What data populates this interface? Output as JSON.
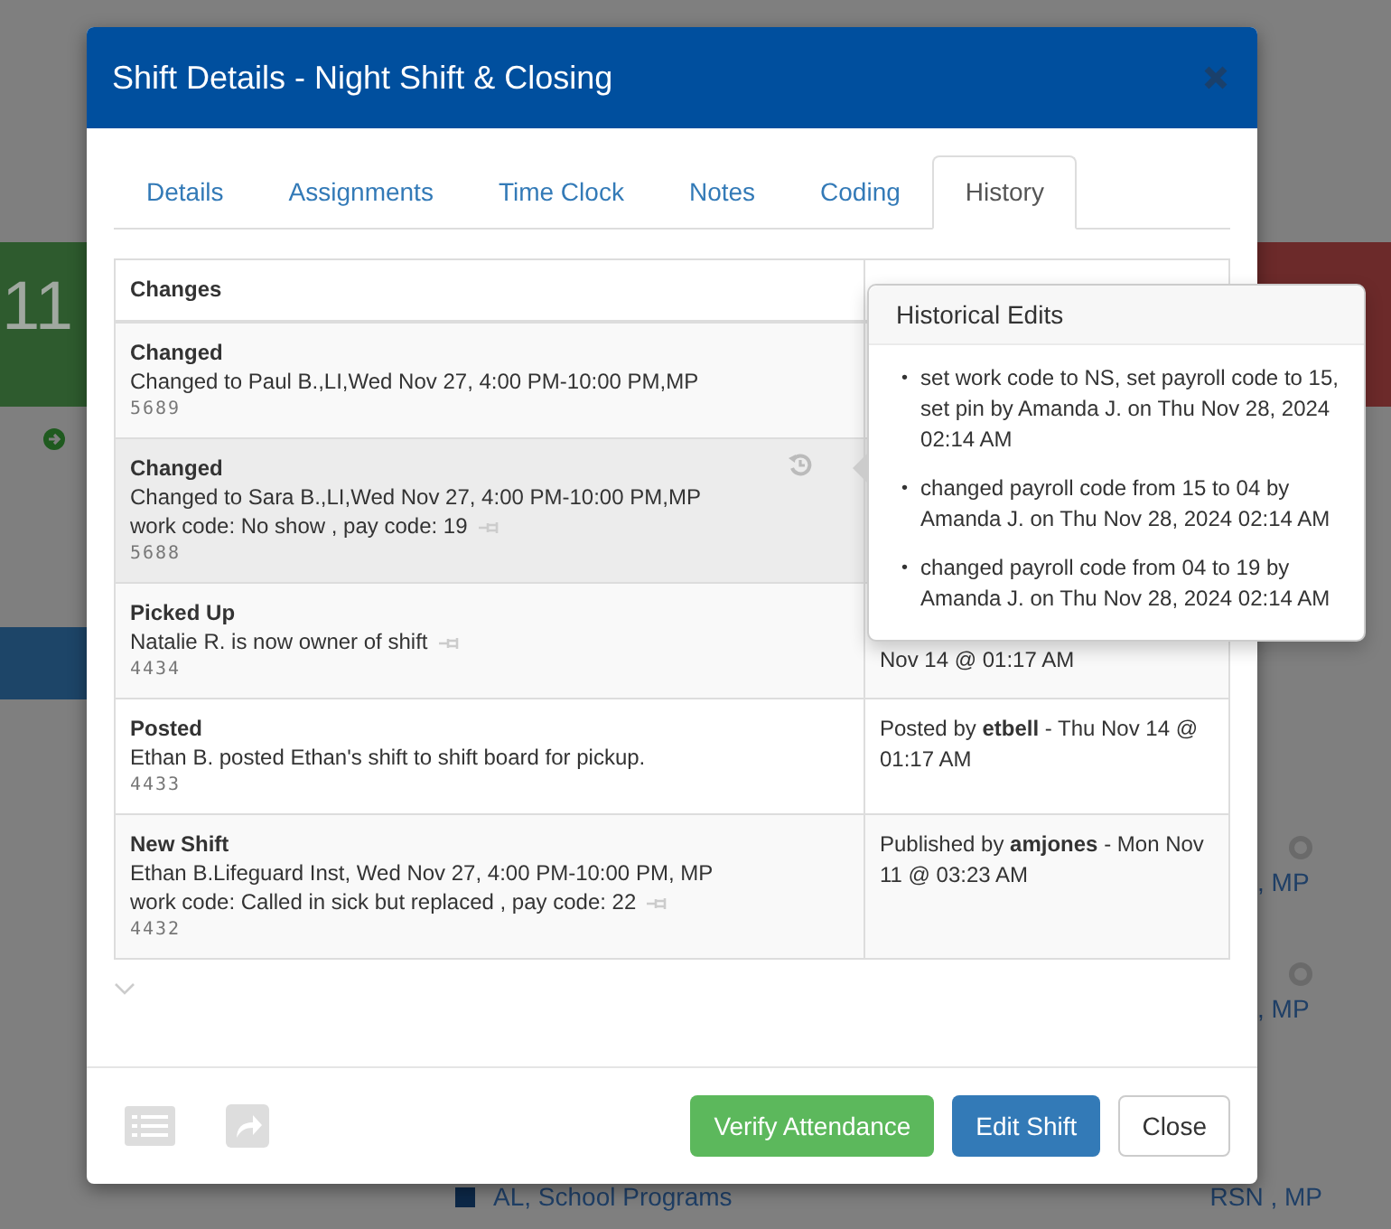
{
  "background": {
    "tile_number": "11",
    "side_codes": [
      ", MP",
      ", MP"
    ],
    "program": "AL, School Programs",
    "program_codes": "RSN , MP"
  },
  "window": {
    "title": "Shift Details - Night Shift & Closing"
  },
  "tabs": [
    {
      "label": "Details",
      "selected": false
    },
    {
      "label": "Assignments",
      "selected": false
    },
    {
      "label": "Time Clock",
      "selected": false
    },
    {
      "label": "Notes",
      "selected": false
    },
    {
      "label": "Coding",
      "selected": false
    },
    {
      "label": "History",
      "selected": true
    }
  ],
  "table": {
    "columns": [
      "Changes"
    ],
    "rows": [
      {
        "action": "Changed",
        "lines": [
          "Changed to Paul B.,LI,Wed Nov 27, 4:00 PM-10:00 PM,MP"
        ],
        "pinned": false,
        "has_history": false,
        "hovered": false,
        "number": "5689"
      },
      {
        "action": "Changed",
        "lines": [
          "Changed to Sara B.,LI,Wed Nov 27, 4:00 PM-10:00 PM,MP",
          "work code: No show , pay code: 19"
        ],
        "pinned": true,
        "has_history": true,
        "hovered": true,
        "number": "5688"
      },
      {
        "action": "Picked Up",
        "lines": [
          "Natalie R. is now owner of shift"
        ],
        "pinned": true,
        "has_history": false,
        "hovered": false,
        "number": "4434",
        "time": "Nov 14 @ 01:17 AM"
      },
      {
        "action": "Posted",
        "lines": [
          "Ethan B. posted Ethan's shift to shift board for pickup."
        ],
        "pinned": false,
        "has_history": false,
        "hovered": false,
        "number": "4433",
        "time": "Posted by **etbell** - Thu Nov 14 @ 01:17 AM"
      },
      {
        "action": "New Shift",
        "lines": [
          "Ethan B.Lifeguard Inst, Wed Nov 27, 4:00 PM-10:00 PM, MP",
          "work code: Called in sick but replaced , pay code: 22"
        ],
        "pinned": true,
        "has_history": false,
        "hovered": false,
        "number": "4432",
        "time": "Published by **amjones** - Mon Nov 11 @ 03:23 AM"
      }
    ]
  },
  "popover": {
    "title": "Historical Edits",
    "items": [
      {
        "bullet": "•",
        "text": "set work code to NS, set payroll code to 15, set pin by Amanda J. on Thu Nov 28, 2024 02:14 AM"
      },
      {
        "bullet": "•",
        "text": "changed payroll code from 15 to 04 by Amanda J. on Thu Nov 28, 2024 02:14 AM"
      },
      {
        "bullet": "•",
        "text": "changed payroll code from 04 to 19 by Amanda J. on Thu Nov 28, 2024 02:14 AM"
      }
    ]
  },
  "buttons": [
    {
      "label": "Verify Attendance",
      "kind": "success"
    },
    {
      "label": "Edit Shift",
      "kind": "primary"
    },
    {
      "label": "Close",
      "kind": "default"
    }
  ]
}
